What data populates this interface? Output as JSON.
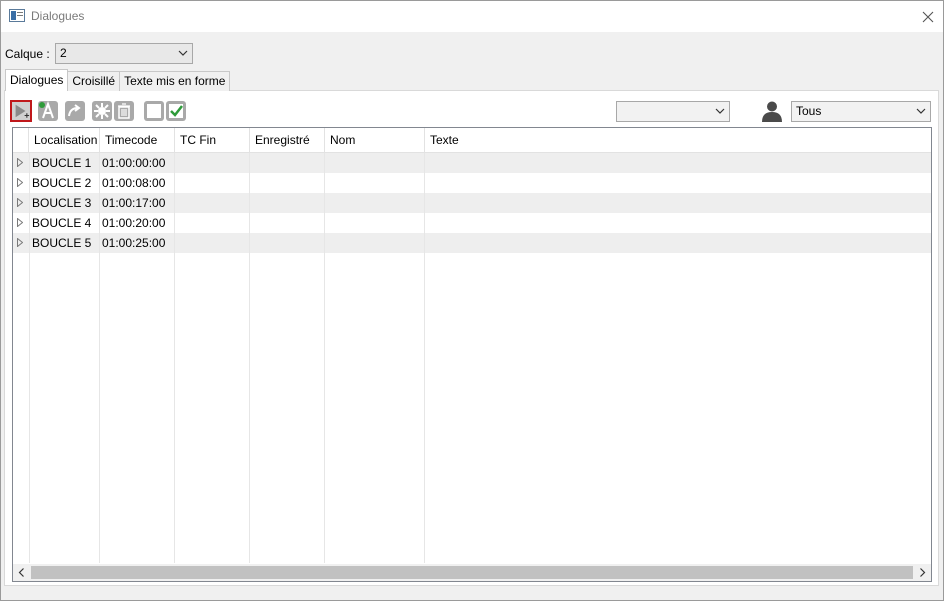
{
  "window": {
    "title": "Dialogues",
    "app_icon": "window-app-icon",
    "close_icon": "close-icon"
  },
  "calque": {
    "label": "Calque :",
    "value": "2"
  },
  "tabs": [
    {
      "label": "Dialogues",
      "active": true
    },
    {
      "label": "Croisillé",
      "active": false
    },
    {
      "label": "Texte mis en forme",
      "active": false
    }
  ],
  "toolbar": {
    "buttons": [
      "play-add-icon",
      "add-text-icon",
      "redo-arrow-icon",
      "settings-gear-icon",
      "trash-icon",
      "unchecked-box-icon",
      "checked-box-icon"
    ]
  },
  "filter": {
    "value": ""
  },
  "user_filter": {
    "icon": "user-icon",
    "value": "Tous"
  },
  "grid": {
    "columns": [
      "Localisation",
      "Timecode",
      "TC Fin",
      "Enregistré",
      "Nom",
      "Texte"
    ],
    "rows": [
      {
        "localisation": "BOUCLE 1",
        "timecode": "01:00:00:00",
        "tc_fin": "",
        "enregistre": "",
        "nom": "",
        "texte": ""
      },
      {
        "localisation": "BOUCLE 2",
        "timecode": "01:00:08:00",
        "tc_fin": "",
        "enregistre": "",
        "nom": "",
        "texte": ""
      },
      {
        "localisation": "BOUCLE 3",
        "timecode": "01:00:17:00",
        "tc_fin": "",
        "enregistre": "",
        "nom": "",
        "texte": ""
      },
      {
        "localisation": "BOUCLE 4",
        "timecode": "01:00:20:00",
        "tc_fin": "",
        "enregistre": "",
        "nom": "",
        "texte": ""
      },
      {
        "localisation": "BOUCLE 5",
        "timecode": "01:00:25:00",
        "tc_fin": "",
        "enregistre": "",
        "nom": "",
        "texte": ""
      }
    ]
  },
  "colors": {
    "selected_border": "#c0181b",
    "alt_row": "#eeeeee",
    "checkmark": "#2e9b3a"
  }
}
